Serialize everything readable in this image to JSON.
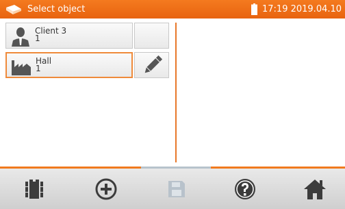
{
  "header": {
    "title": "Select object",
    "time_date": "17:19 2019.04.10",
    "logo_icon": "brand-logo-icon",
    "battery_icon": "battery-icon"
  },
  "objects": [
    {
      "name": "Client 3",
      "number": "1",
      "icon": "person-icon",
      "selected": false,
      "action_icon": ""
    },
    {
      "name": "Hall",
      "number": "1",
      "icon": "factory-icon",
      "selected": true,
      "action_icon": "pencil-icon"
    }
  ],
  "toolbar": {
    "buttons": [
      {
        "icon": "structure-icon",
        "enabled": true
      },
      {
        "icon": "add-circle-icon",
        "enabled": true
      },
      {
        "icon": "save-icon",
        "enabled": false
      },
      {
        "icon": "help-icon",
        "enabled": true
      },
      {
        "icon": "home-icon",
        "enabled": true
      }
    ]
  },
  "colors": {
    "accent": "#f07a1e",
    "toolbar_icon": "#3c3c3c",
    "disabled_icon": "#b8c2cb"
  }
}
